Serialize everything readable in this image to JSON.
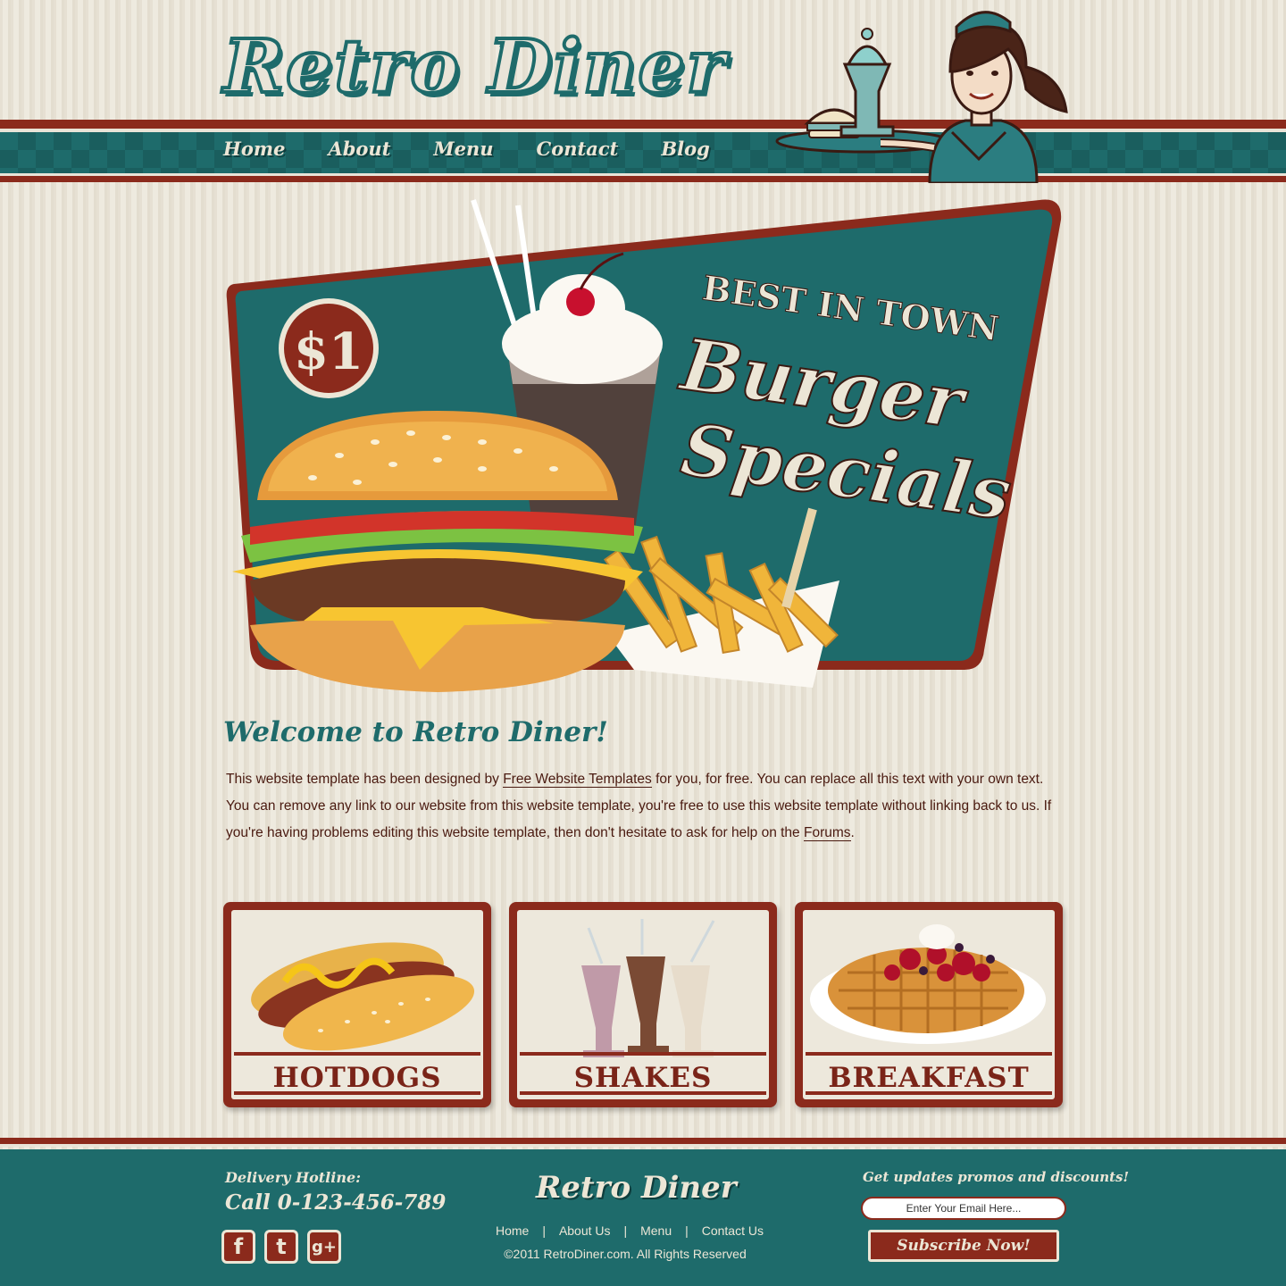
{
  "site": {
    "logo": "Retro Diner"
  },
  "nav": {
    "items": [
      "Home",
      "About",
      "Menu",
      "Contact",
      "Blog"
    ]
  },
  "hero": {
    "price": "$1",
    "tagline": "BEST IN TOWN",
    "headline_line1": "Burger",
    "headline_line2": "Specials"
  },
  "welcome": {
    "title": "Welcome to Retro Diner!",
    "text_1": "This website template has been designed by ",
    "link_1": "Free Website Templates",
    "text_2": " for you, for free. You can replace all this text with your own text. You can remove any link to our website from this website template, you're free to use this website template without linking back to us. If you're having problems editing this website template, then don't hesitate to ask for help on the ",
    "link_2": "Forums",
    "text_3": "."
  },
  "cards": [
    {
      "label": "HOTDOGS"
    },
    {
      "label": "SHAKES"
    },
    {
      "label": "BREAKFAST"
    }
  ],
  "footer": {
    "hotline_label": "Delivery Hotline:",
    "hotline": "Call 0-123-456-789",
    "social": [
      "f",
      "t",
      "g+"
    ],
    "logo": "Retro Diner",
    "links": [
      "Home",
      "About Us",
      "Menu",
      "Contact Us"
    ],
    "copyright": "©2011 RetroDiner.com. All Rights Reserved",
    "promo_label": "Get updates promos and discounts!",
    "email_placeholder": "Enter Your Email Here...",
    "subscribe_label": "Subscribe Now!"
  },
  "colors": {
    "teal": "#1e6b6b",
    "maroon": "#8b2a1c",
    "cream": "#ece6d6"
  },
  "icons": [
    "facebook-icon",
    "twitter-icon",
    "google-plus-icon"
  ]
}
